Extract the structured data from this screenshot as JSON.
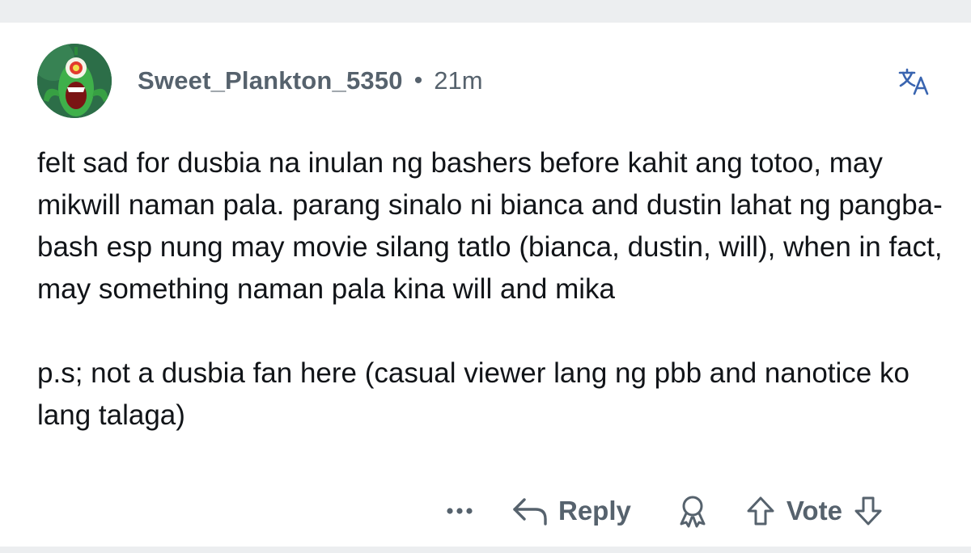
{
  "comment": {
    "username": "Sweet_Plankton_5350",
    "separator": "•",
    "time_ago": "21m",
    "paragraphs": [
      "felt sad for dusbia na inulan ng bashers before kahit ang totoo, may mikwill naman pala. parang sinalo ni bianca and dustin lahat ng pangba-bash esp nung may movie silang tatlo (bianca, dustin, will), when in fact, may something naman pala kina will and mika",
      "p.s; not a dusbia fan here (casual viewer lang ng pbb and nanotice ko lang talaga)"
    ]
  },
  "actions": {
    "more_label": "•••",
    "reply_label": "Reply",
    "vote_label": "Vote"
  },
  "icons": {
    "avatar": "plankton-avatar",
    "translate": "translate-icon",
    "more": "more-options-icon",
    "reply": "reply-arrow-icon",
    "award": "award-icon",
    "upvote": "upvote-arrow-icon",
    "downvote": "downvote-arrow-icon"
  },
  "colors": {
    "meta_text": "#56626d",
    "body_text": "#111418",
    "band": "#eceef0"
  }
}
